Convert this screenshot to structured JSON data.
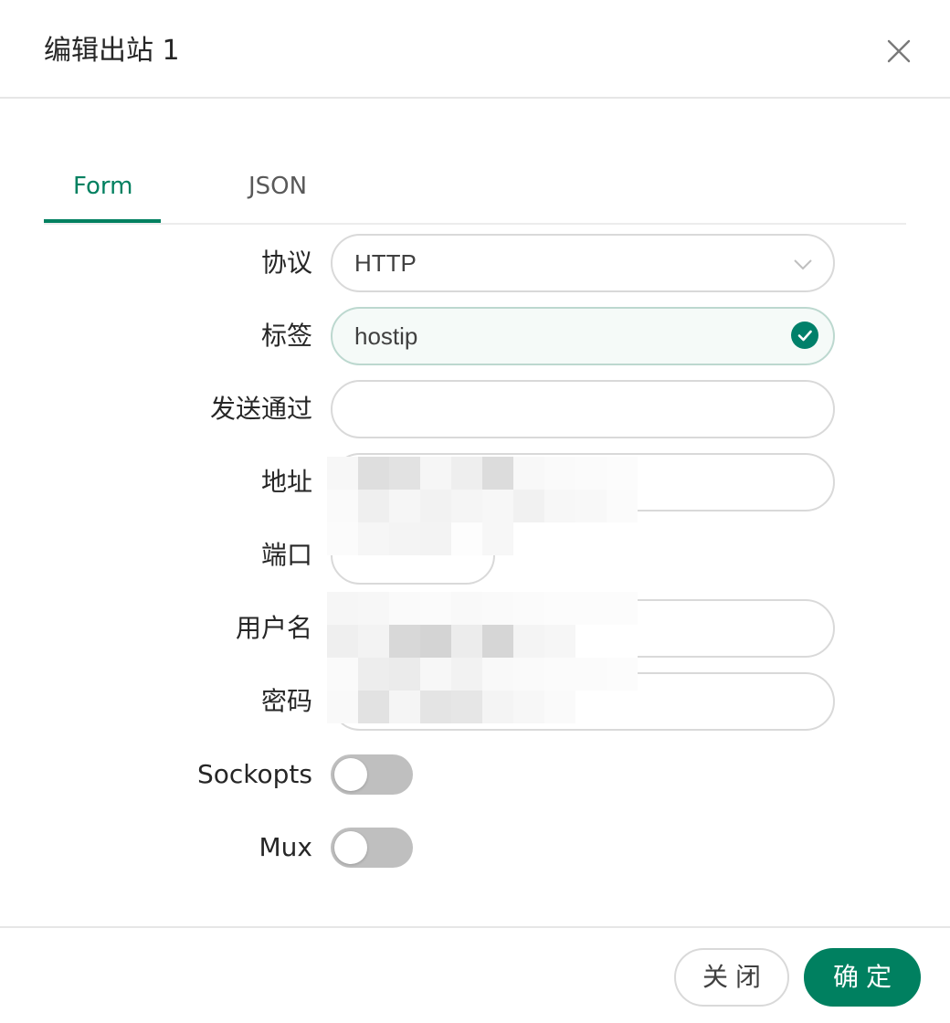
{
  "dialog": {
    "title": "编辑出站 1"
  },
  "tabs": [
    {
      "label": "Form",
      "active": true
    },
    {
      "label": "JSON",
      "active": false
    }
  ],
  "form": {
    "protocol": {
      "label": "协议",
      "value": "HTTP"
    },
    "tag": {
      "label": "标签",
      "value": "hostip",
      "validated": true
    },
    "send_through": {
      "label": "发送通过",
      "value": ""
    },
    "address": {
      "label": "地址",
      "value": ""
    },
    "port": {
      "label": "端口",
      "value": ""
    },
    "username": {
      "label": "用户名",
      "value": ""
    },
    "password": {
      "label": "密码",
      "value": ""
    },
    "sockopts": {
      "label": "Sockopts",
      "enabled": false
    },
    "mux": {
      "label": "Mux",
      "enabled": false
    }
  },
  "footer": {
    "close_label": "关闭",
    "ok_label": "确定"
  },
  "colors": {
    "accent": "#008060",
    "toggle_off": "#bfbfbf",
    "border": "#d9d9d9"
  }
}
